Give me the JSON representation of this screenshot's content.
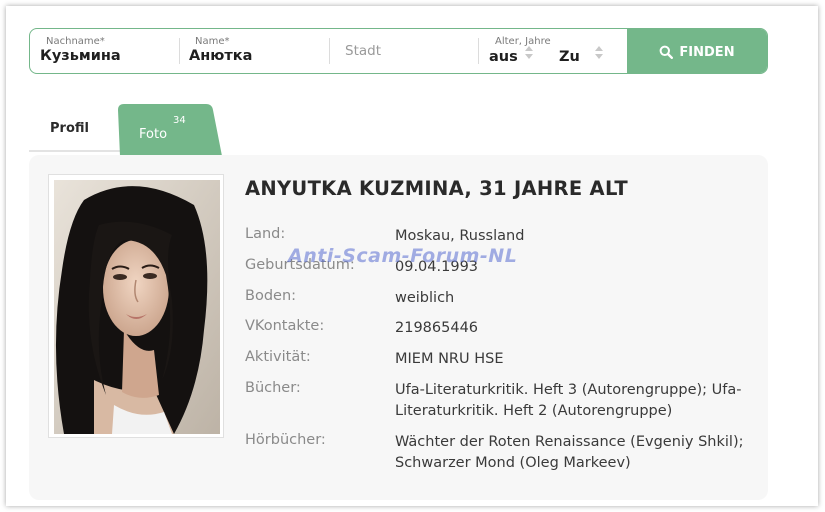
{
  "search": {
    "lastname_label": "Nachname*",
    "lastname_value": "Кузьмина",
    "name_label": "Name*",
    "name_value": "Анютка",
    "city_placeholder": "Stadt",
    "age_label": "Alter, Jahre",
    "age_from": "aus",
    "age_to": "Zu",
    "find_label": "FINDEN"
  },
  "tabs": {
    "profil": "Profil",
    "foto": "Foto",
    "foto_count": "34"
  },
  "profile": {
    "title": "ANYUTKA KUZMINA, 31 JAHRE ALT",
    "rows": [
      {
        "label": "Land:",
        "value": "Moskau, Russland"
      },
      {
        "label": "Geburtsdatum:",
        "value": "09.04.1993"
      },
      {
        "label": "Boden:",
        "value": "weiblich"
      },
      {
        "label": "VKontakte:",
        "value": "219865446"
      },
      {
        "label": "Aktivität:",
        "value": "MIEM NRU HSE"
      },
      {
        "label": "Bücher:",
        "value": "Ufa-Literaturkritik. Heft 3 (Autorengruppe); Ufa-Literaturkritik. Heft 2 (Autorengruppe)"
      },
      {
        "label": "Hörbücher:",
        "value": "Wächter der Roten Renaissance (Evgeniy Shkil); Schwarzer Mond (Oleg Markeev)"
      }
    ]
  },
  "watermark": "Anti-Scam-Forum-NL",
  "colors": {
    "accent": "#74b78a",
    "card": "#f7f7f7"
  }
}
